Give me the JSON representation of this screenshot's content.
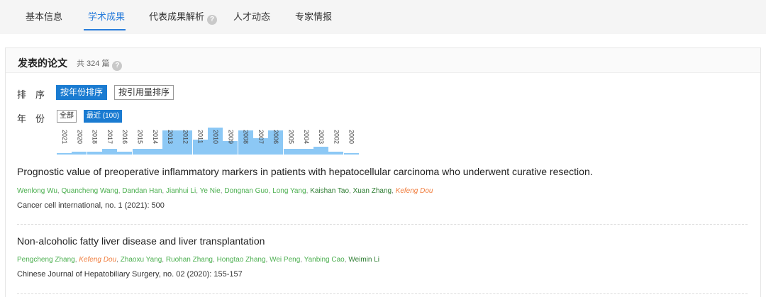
{
  "tabs": [
    {
      "label": "基本信息"
    },
    {
      "label": "学术成果"
    },
    {
      "label": "代表成果解析"
    },
    {
      "label": "人才动态"
    },
    {
      "label": "专家情报"
    }
  ],
  "panel": {
    "title": "发表的论文",
    "count": "共 324 篇",
    "sort_label": "排　序",
    "sort_by_year": "按年份排序",
    "sort_by_citation": "按引用量排序",
    "year_label": "年　份",
    "year_all": "全部",
    "year_recent": "最近 (100)"
  },
  "year_chart": [
    {
      "year": "2021",
      "level": 0.05
    },
    {
      "year": "2020",
      "level": 0.1
    },
    {
      "year": "2018",
      "level": 0.1
    },
    {
      "year": "2017",
      "level": 0.2
    },
    {
      "year": "2016",
      "level": 0.1
    },
    {
      "year": "2015",
      "level": 0.2
    },
    {
      "year": "2014",
      "level": 0.2
    },
    {
      "year": "2013",
      "level": 0.9
    },
    {
      "year": "2012",
      "level": 0.9
    },
    {
      "year": "2011",
      "level": 0.55
    },
    {
      "year": "2010",
      "level": 1.0
    },
    {
      "year": "2009",
      "level": 0.5
    },
    {
      "year": "2008",
      "level": 0.9
    },
    {
      "year": "2007",
      "level": 0.6
    },
    {
      "year": "2006",
      "level": 0.9
    },
    {
      "year": "2005",
      "level": 0.2
    },
    {
      "year": "2004",
      "level": 0.2
    },
    {
      "year": "2003",
      "level": 0.3
    },
    {
      "year": "2002",
      "level": 0.1
    },
    {
      "year": "2000",
      "level": 0.05
    }
  ],
  "papers": [
    {
      "title": "Prognostic value of preoperative inflammatory markers in patients with hepatocellular carcinoma who underwent curative resection.",
      "authors": [
        {
          "name": "Wenlong Wu",
          "style": "normal"
        },
        {
          "name": "Quancheng Wang",
          "style": "normal"
        },
        {
          "name": "Dandan Han",
          "style": "normal"
        },
        {
          "name": "Jianhui Li",
          "style": "normal"
        },
        {
          "name": "Ye Nie",
          "style": "normal"
        },
        {
          "name": "Dongnan Guo",
          "style": "normal"
        },
        {
          "name": "Long Yang",
          "style": "normal"
        },
        {
          "name": "Kaishan Tao",
          "style": "dark"
        },
        {
          "name": "Xuan Zhang",
          "style": "dark"
        },
        {
          "name": "Kefeng Dou",
          "style": "highlight"
        }
      ],
      "venue": "Cancer cell international, no. 1 (2021): 500"
    },
    {
      "title": "Non-alcoholic fatty liver disease and liver transplantation",
      "authors": [
        {
          "name": "Pengcheng Zhang",
          "style": "normal"
        },
        {
          "name": "Kefeng Dou",
          "style": "highlight"
        },
        {
          "name": "Zhaoxu Yang",
          "style": "normal"
        },
        {
          "name": "Ruohan Zhang",
          "style": "normal"
        },
        {
          "name": "Hongtao Zhang",
          "style": "normal"
        },
        {
          "name": "Wei Peng",
          "style": "normal"
        },
        {
          "name": "Yanbing Cao",
          "style": "normal"
        },
        {
          "name": "Weimin Li",
          "style": "dark"
        }
      ],
      "venue": "Chinese Journal of Hepatobiliary Surgery, no. 02 (2020): 155-157"
    }
  ],
  "colors": {
    "accent": "#2a7ddb",
    "primary_button": "#1a7bd1",
    "bar": "#8cc8f5",
    "author": "#4caf50",
    "author_dark": "#2e7d32",
    "author_highlight": "#f07c3c"
  }
}
